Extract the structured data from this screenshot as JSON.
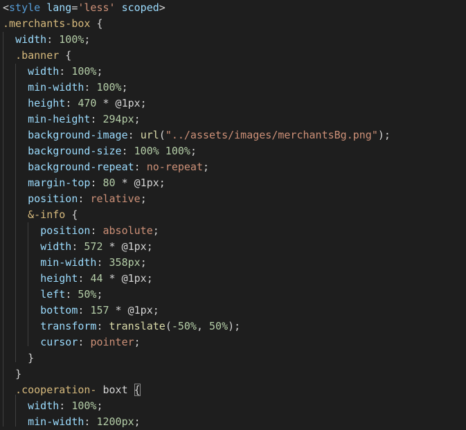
{
  "lines": [
    {
      "tokens": [
        {
          "t": "<",
          "c": "punc"
        },
        {
          "t": "style",
          "c": "tag"
        },
        {
          "t": " ",
          "c": "punc"
        },
        {
          "t": "lang",
          "c": "attr"
        },
        {
          "t": "=",
          "c": "punc"
        },
        {
          "t": "'less'",
          "c": "str"
        },
        {
          "t": " ",
          "c": "punc"
        },
        {
          "t": "scoped",
          "c": "attr"
        },
        {
          "t": ">",
          "c": "punc"
        }
      ]
    },
    {
      "tokens": [
        {
          "t": ".merchants-box",
          "c": "sel"
        },
        {
          "t": " {",
          "c": "punc"
        }
      ]
    },
    {
      "tokens": [
        {
          "t": "  ",
          "c": "punc"
        },
        {
          "t": "width",
          "c": "prop"
        },
        {
          "t": ": ",
          "c": "punc"
        },
        {
          "t": "100%",
          "c": "num"
        },
        {
          "t": ";",
          "c": "punc"
        }
      ]
    },
    {
      "tokens": [
        {
          "t": "  ",
          "c": "punc"
        },
        {
          "t": ".banner",
          "c": "sel"
        },
        {
          "t": " {",
          "c": "punc"
        }
      ]
    },
    {
      "tokens": [
        {
          "t": "    ",
          "c": "punc"
        },
        {
          "t": "width",
          "c": "prop"
        },
        {
          "t": ": ",
          "c": "punc"
        },
        {
          "t": "100%",
          "c": "num"
        },
        {
          "t": ";",
          "c": "punc"
        }
      ]
    },
    {
      "tokens": [
        {
          "t": "    ",
          "c": "punc"
        },
        {
          "t": "min-width",
          "c": "prop"
        },
        {
          "t": ": ",
          "c": "punc"
        },
        {
          "t": "100%",
          "c": "num"
        },
        {
          "t": ";",
          "c": "punc"
        }
      ]
    },
    {
      "tokens": [
        {
          "t": "    ",
          "c": "punc"
        },
        {
          "t": "height",
          "c": "prop"
        },
        {
          "t": ": ",
          "c": "punc"
        },
        {
          "t": "470",
          "c": "num"
        },
        {
          "t": " * @1px;",
          "c": "punc"
        }
      ]
    },
    {
      "tokens": [
        {
          "t": "    ",
          "c": "punc"
        },
        {
          "t": "min-height",
          "c": "prop"
        },
        {
          "t": ": ",
          "c": "punc"
        },
        {
          "t": "294px",
          "c": "num"
        },
        {
          "t": ";",
          "c": "punc"
        }
      ]
    },
    {
      "tokens": [
        {
          "t": "    ",
          "c": "punc"
        },
        {
          "t": "background-image",
          "c": "prop"
        },
        {
          "t": ": ",
          "c": "punc"
        },
        {
          "t": "url",
          "c": "fn"
        },
        {
          "t": "(",
          "c": "punc"
        },
        {
          "t": "\"../assets/images/merchantsBg.png\"",
          "c": "str"
        },
        {
          "t": ");",
          "c": "punc"
        }
      ]
    },
    {
      "tokens": [
        {
          "t": "    ",
          "c": "punc"
        },
        {
          "t": "background-size",
          "c": "prop"
        },
        {
          "t": ": ",
          "c": "punc"
        },
        {
          "t": "100% 100%",
          "c": "num"
        },
        {
          "t": ";",
          "c": "punc"
        }
      ]
    },
    {
      "tokens": [
        {
          "t": "    ",
          "c": "punc"
        },
        {
          "t": "background-repeat",
          "c": "prop"
        },
        {
          "t": ": ",
          "c": "punc"
        },
        {
          "t": "no-repeat",
          "c": "kw"
        },
        {
          "t": ";",
          "c": "punc"
        }
      ]
    },
    {
      "tokens": [
        {
          "t": "    ",
          "c": "punc"
        },
        {
          "t": "margin-top",
          "c": "prop"
        },
        {
          "t": ": ",
          "c": "punc"
        },
        {
          "t": "80",
          "c": "num"
        },
        {
          "t": " * @1px;",
          "c": "punc"
        }
      ]
    },
    {
      "tokens": [
        {
          "t": "    ",
          "c": "punc"
        },
        {
          "t": "position",
          "c": "prop"
        },
        {
          "t": ": ",
          "c": "punc"
        },
        {
          "t": "relative",
          "c": "kw"
        },
        {
          "t": ";",
          "c": "punc"
        }
      ]
    },
    {
      "tokens": [
        {
          "t": "    ",
          "c": "punc"
        },
        {
          "t": "&-info",
          "c": "sel"
        },
        {
          "t": " {",
          "c": "punc"
        }
      ]
    },
    {
      "tokens": [
        {
          "t": "      ",
          "c": "punc"
        },
        {
          "t": "position",
          "c": "prop"
        },
        {
          "t": ": ",
          "c": "punc"
        },
        {
          "t": "absolute",
          "c": "kw"
        },
        {
          "t": ";",
          "c": "punc"
        }
      ]
    },
    {
      "tokens": [
        {
          "t": "      ",
          "c": "punc"
        },
        {
          "t": "width",
          "c": "prop"
        },
        {
          "t": ": ",
          "c": "punc"
        },
        {
          "t": "572",
          "c": "num"
        },
        {
          "t": " * @1px;",
          "c": "punc"
        }
      ]
    },
    {
      "tokens": [
        {
          "t": "      ",
          "c": "punc"
        },
        {
          "t": "min-width",
          "c": "prop"
        },
        {
          "t": ": ",
          "c": "punc"
        },
        {
          "t": "358px",
          "c": "num"
        },
        {
          "t": ";",
          "c": "punc"
        }
      ]
    },
    {
      "tokens": [
        {
          "t": "      ",
          "c": "punc"
        },
        {
          "t": "height",
          "c": "prop"
        },
        {
          "t": ": ",
          "c": "punc"
        },
        {
          "t": "44",
          "c": "num"
        },
        {
          "t": " * @1px;",
          "c": "punc"
        }
      ]
    },
    {
      "tokens": [
        {
          "t": "      ",
          "c": "punc"
        },
        {
          "t": "left",
          "c": "prop"
        },
        {
          "t": ": ",
          "c": "punc"
        },
        {
          "t": "50%",
          "c": "num"
        },
        {
          "t": ";",
          "c": "punc"
        }
      ]
    },
    {
      "tokens": [
        {
          "t": "      ",
          "c": "punc"
        },
        {
          "t": "bottom",
          "c": "prop"
        },
        {
          "t": ": ",
          "c": "punc"
        },
        {
          "t": "157",
          "c": "num"
        },
        {
          "t": " * @1px;",
          "c": "punc"
        }
      ]
    },
    {
      "tokens": [
        {
          "t": "      ",
          "c": "punc"
        },
        {
          "t": "transform",
          "c": "prop"
        },
        {
          "t": ": ",
          "c": "punc"
        },
        {
          "t": "translate",
          "c": "fn"
        },
        {
          "t": "(",
          "c": "punc"
        },
        {
          "t": "-50%",
          "c": "num"
        },
        {
          "t": ", ",
          "c": "punc"
        },
        {
          "t": "50%",
          "c": "num"
        },
        {
          "t": ");",
          "c": "punc"
        }
      ]
    },
    {
      "tokens": [
        {
          "t": "      ",
          "c": "punc"
        },
        {
          "t": "cursor",
          "c": "prop"
        },
        {
          "t": ": ",
          "c": "punc"
        },
        {
          "t": "pointer",
          "c": "kw"
        },
        {
          "t": ";",
          "c": "punc"
        }
      ]
    },
    {
      "tokens": [
        {
          "t": "    ",
          "c": "punc"
        },
        {
          "t": "}",
          "c": "punc"
        }
      ]
    },
    {
      "tokens": [
        {
          "t": "  ",
          "c": "punc"
        },
        {
          "t": "}",
          "c": "punc"
        }
      ]
    },
    {
      "tokens": [
        {
          "t": "  ",
          "c": "punc"
        },
        {
          "t": ".cooperation-",
          "c": "sel"
        },
        {
          "t": " boxt ",
          "c": "punc"
        },
        {
          "t": "{",
          "c": "punc",
          "hl": true
        }
      ]
    },
    {
      "tokens": [
        {
          "t": "    ",
          "c": "punc"
        },
        {
          "t": "width",
          "c": "prop"
        },
        {
          "t": ": ",
          "c": "punc"
        },
        {
          "t": "100%",
          "c": "num"
        },
        {
          "t": ";",
          "c": "punc"
        }
      ]
    },
    {
      "tokens": [
        {
          "t": "    ",
          "c": "punc"
        },
        {
          "t": "min-width",
          "c": "prop"
        },
        {
          "t": ": ",
          "c": "punc"
        },
        {
          "t": "1200px",
          "c": "num"
        },
        {
          "t": ";",
          "c": "punc"
        }
      ]
    }
  ]
}
